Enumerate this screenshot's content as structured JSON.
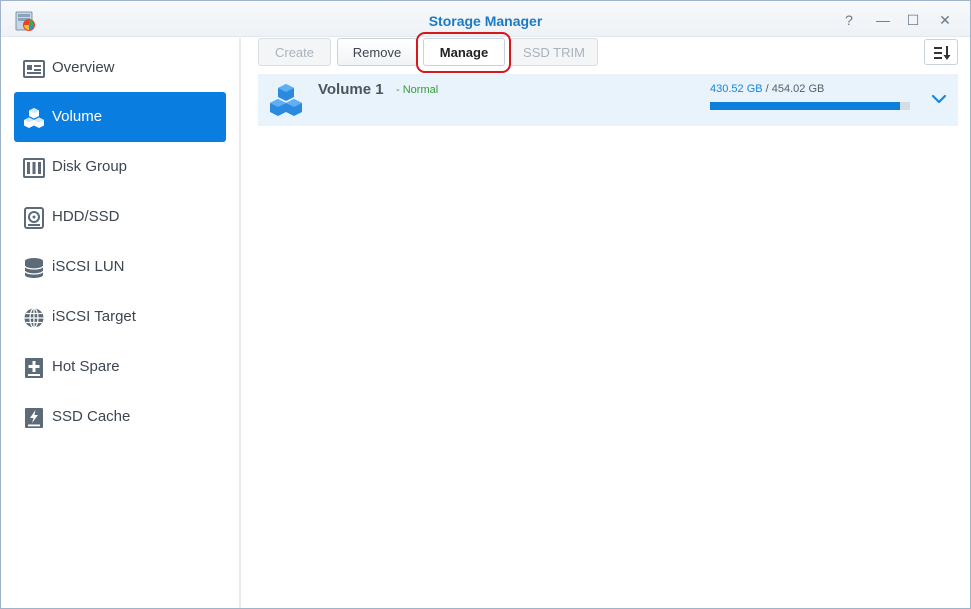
{
  "window": {
    "title": "Storage Manager",
    "controls": {
      "help": "?",
      "minimize": "—",
      "maximize": "☐",
      "close": "✕"
    }
  },
  "sidebar": {
    "items": [
      {
        "label": "Overview",
        "icon": "overview-icon",
        "active": false
      },
      {
        "label": "Volume",
        "icon": "volume-cubes-icon",
        "active": true
      },
      {
        "label": "Disk Group",
        "icon": "disk-group-icon",
        "active": false
      },
      {
        "label": "HDD/SSD",
        "icon": "hdd-icon",
        "active": false
      },
      {
        "label": "iSCSI LUN",
        "icon": "iscsi-lun-icon",
        "active": false
      },
      {
        "label": "iSCSI Target",
        "icon": "iscsi-target-icon",
        "active": false
      },
      {
        "label": "Hot Spare",
        "icon": "hot-spare-icon",
        "active": false
      },
      {
        "label": "SSD Cache",
        "icon": "ssd-cache-icon",
        "active": false
      }
    ]
  },
  "toolbar": {
    "create_label": "Create",
    "remove_label": "Remove",
    "manage_label": "Manage",
    "ssd_trim_label": "SSD TRIM"
  },
  "volume": {
    "name": "Volume 1",
    "status": "- Normal",
    "used": "430.52 GB",
    "separator": " / ",
    "total": "454.02 GB",
    "usage_fraction": 0.948
  },
  "colors": {
    "accent": "#0a7ee0",
    "title": "#1a7bc4",
    "status_ok": "#3a9a3a",
    "highlight": "#d8161b"
  }
}
